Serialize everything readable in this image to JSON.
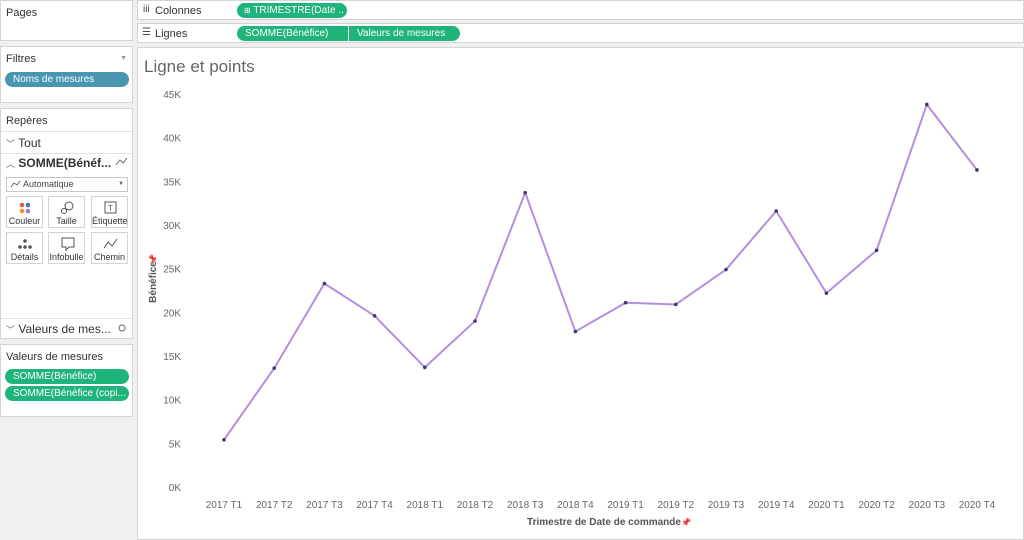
{
  "pages": {
    "title": "Pages"
  },
  "filters": {
    "title": "Filtres",
    "pill": "Noms de mesures"
  },
  "marks": {
    "title": "Repères",
    "all_label": "Tout",
    "measure_label": "SOMME(Bénéf...",
    "mark_type": "Automatique",
    "buttons": [
      "Couleur",
      "Taille",
      "Étiquette",
      "Détails",
      "Infobulle",
      "Chemin"
    ],
    "values_label": "Valeurs de mes..."
  },
  "measure_values": {
    "title": "Valeurs de mesures",
    "items": [
      "SOMME(Bénéfice)",
      "SOMME(Bénéfice (copi..."
    ]
  },
  "shelves": {
    "columns_label": "Colonnes",
    "columns_pill": "TRIMESTRE(Date ..",
    "rows_label": "Lignes",
    "rows_pills": [
      "SOMME(Bénéfice)",
      "Valeurs de mesures"
    ]
  },
  "chart_data": {
    "type": "line",
    "title": "Ligne et points",
    "xlabel": "Trimestre de Date de commande",
    "ylabel": "Bénéfice",
    "categories": [
      "2017 T1",
      "2017 T2",
      "2017 T3",
      "2017 T4",
      "2018 T1",
      "2018 T2",
      "2018 T3",
      "2018 T4",
      "2019 T1",
      "2019 T2",
      "2019 T3",
      "2019 T4",
      "2020 T1",
      "2020 T2",
      "2020 T3",
      "2020 T4"
    ],
    "series": [
      {
        "values": [
          5400,
          13600,
          23300,
          19600,
          13700,
          19000,
          33700,
          17800,
          21100,
          20900,
          24900,
          31600,
          22200,
          27100,
          43800,
          36300
        ],
        "color": "#b48ee0"
      }
    ],
    "yticks": [
      "0K",
      "5K",
      "10K",
      "15K",
      "20K",
      "25K",
      "30K",
      "35K",
      "40K",
      "45K"
    ],
    "ylim": [
      0,
      45000
    ]
  }
}
